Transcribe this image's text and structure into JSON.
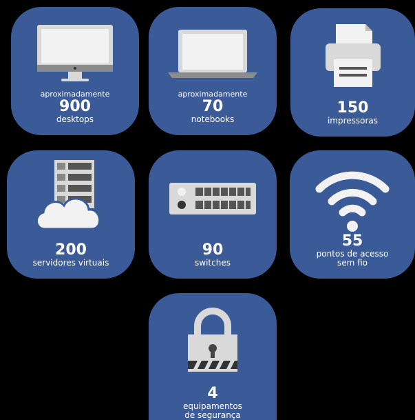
{
  "tiles": {
    "desktops": {
      "pre": "aproximadamente",
      "value": "900",
      "label": "desktops",
      "icon": "desktop-monitor-icon"
    },
    "notebooks": {
      "pre": "aproximadamente",
      "value": "70",
      "label": "notebooks",
      "icon": "laptop-icon"
    },
    "printers": {
      "value": "150",
      "label": "impressoras",
      "icon": "printer-icon"
    },
    "servers": {
      "value": "200",
      "label": "servidores virtuais",
      "icon": "server-cloud-icon"
    },
    "switches": {
      "value": "90",
      "label": "switches",
      "icon": "network-switch-icon"
    },
    "wifi": {
      "value": "55",
      "label1": "pontos de acesso",
      "label2": "sem fio",
      "icon": "wifi-icon"
    },
    "security": {
      "value": "4",
      "label1": "equipamentos",
      "label2": "de segurança",
      "icon": "padlock-icon"
    }
  },
  "colors": {
    "tile": "#3a5a98",
    "background": "#000000"
  }
}
